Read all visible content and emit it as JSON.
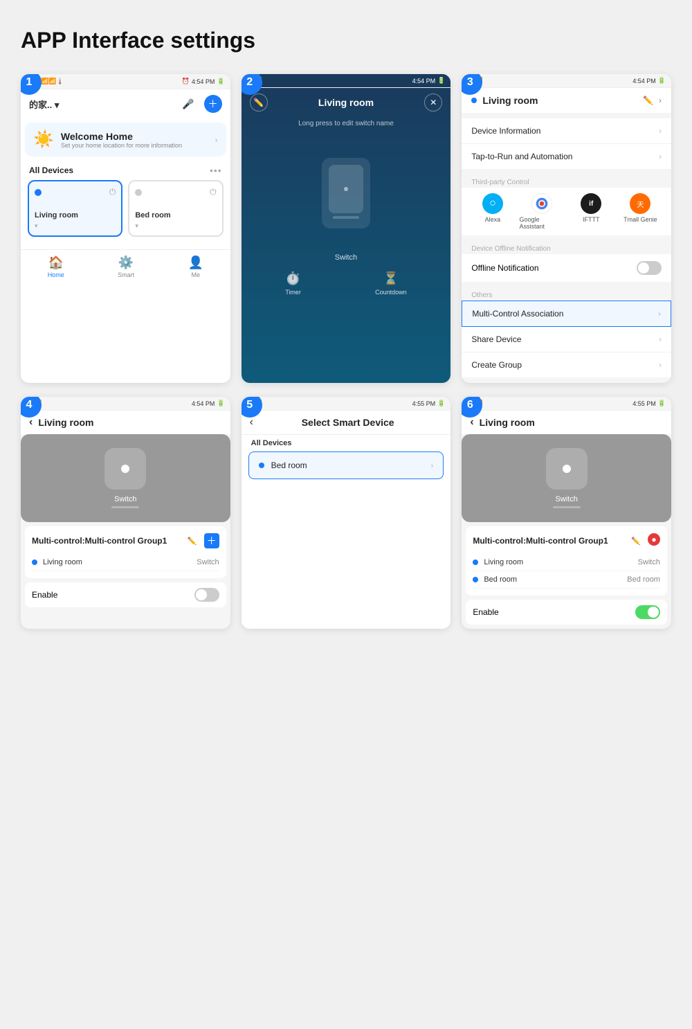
{
  "page": {
    "title": "APP Interface settings"
  },
  "status_bar": {
    "time": "4:54 PM",
    "time2": "4:55 PM",
    "signal": "📶",
    "battery": "🔋"
  },
  "screen1": {
    "home_name": "的家.. ▾",
    "welcome_title": "Welcome Home",
    "welcome_sub": "Set your home location for more information",
    "all_devices": "All Devices",
    "devices": [
      {
        "name": "Living room",
        "active": true
      },
      {
        "name": "Bed room",
        "active": false
      }
    ],
    "nav": [
      "Home",
      "Smart",
      "Me"
    ]
  },
  "screen2": {
    "title": "Living room",
    "hint": "Long press to edit switch name",
    "device_label": "Switch",
    "actions": [
      "Timer",
      "Countdown"
    ]
  },
  "screen3": {
    "device_name": "Living room",
    "menu_items": [
      {
        "label": "Device Information",
        "highlighted": false
      },
      {
        "label": "Tap-to-Run and Automation",
        "highlighted": false
      }
    ],
    "third_party_label": "Third-party Control",
    "third_party": [
      "Alexa",
      "Google Assistant",
      "IFTTT",
      "Tmall Genie"
    ],
    "offline_label": "Device Offline Notification",
    "offline_toggle": "Offline Notification",
    "others_label": "Others",
    "others_items": [
      {
        "label": "Multi-Control Association",
        "highlighted": true
      },
      {
        "label": "Share Device",
        "highlighted": false
      },
      {
        "label": "Create Group",
        "highlighted": false
      }
    ]
  },
  "screen4": {
    "title": "Living room",
    "device_label": "Switch",
    "multi_control_title": "Multi-control:Multi-control Group1",
    "control_items": [
      {
        "room": "Living room",
        "device": "Switch"
      }
    ],
    "enable_label": "Enable"
  },
  "screen5": {
    "title": "Select Smart Device",
    "all_devices_label": "All Devices",
    "devices": [
      {
        "name": "Bed room"
      }
    ]
  },
  "screen6": {
    "title": "Living room",
    "device_label": "Switch",
    "multi_control_title": "Multi-control:Multi-control Group1",
    "control_items": [
      {
        "room": "Living room",
        "device": "Switch"
      },
      {
        "room": "Bed room",
        "device": "Bed room"
      }
    ],
    "enable_label": "Enable",
    "enable_on": true
  },
  "steps": [
    "1",
    "2",
    "3",
    "4",
    "5",
    "6"
  ]
}
